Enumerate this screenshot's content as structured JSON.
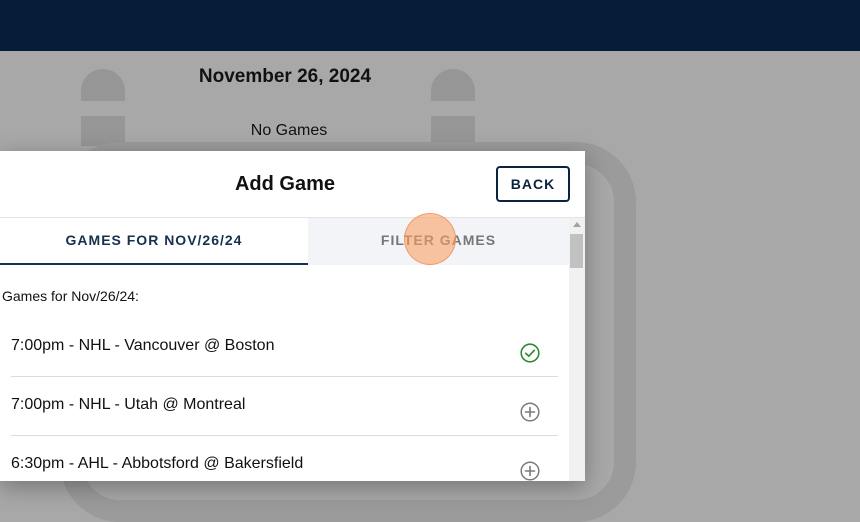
{
  "background": {
    "date": "November 26, 2024",
    "no_games": "No Games"
  },
  "modal": {
    "title": "Add Game",
    "back_label": "BACK",
    "tabs": [
      {
        "label": "GAMES FOR NOV/26/24",
        "active": true
      },
      {
        "label": "FILTER GAMES",
        "active": false
      }
    ],
    "section_label": "Games for Nov/26/24:",
    "games": [
      {
        "label": "7:00pm - NHL - Vancouver @ Boston",
        "icon": "check-circle-icon"
      },
      {
        "label": "7:00pm - NHL - Utah @ Montreal",
        "icon": "add-circle-icon"
      },
      {
        "label": "6:30pm - AHL - Abbotsford @ Bakersfield",
        "icon": "add-circle-icon"
      }
    ]
  },
  "colors": {
    "topbar": "#061d39",
    "accent": "#17304f",
    "check": "#2e8b2e",
    "add_icon": "#7a7a7a"
  }
}
